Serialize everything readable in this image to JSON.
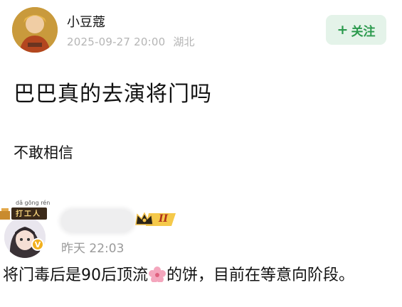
{
  "post": {
    "author": "小豆蔻",
    "timestamp": "2025-09-27 20:00",
    "location": "湖北",
    "follow_label": "关注",
    "follow_plus": "+",
    "title": "巴巴真的去演将门吗",
    "body": "不敢相信"
  },
  "comment": {
    "badge_pinyin": "dǎ gōng rén",
    "badge_text": "打工人",
    "verified_mark": "V",
    "level_label": "II",
    "time": "昨天 22:03",
    "text_part1": "将门毒后是90后顶流",
    "text_part2": "的饼，目前在等意向阶段。"
  },
  "colors": {
    "follow_bg": "#e4f3e9",
    "follow_text": "#2b9a4d",
    "meta_text": "#b5b5b5",
    "badge_gold": "#f2b01e"
  }
}
